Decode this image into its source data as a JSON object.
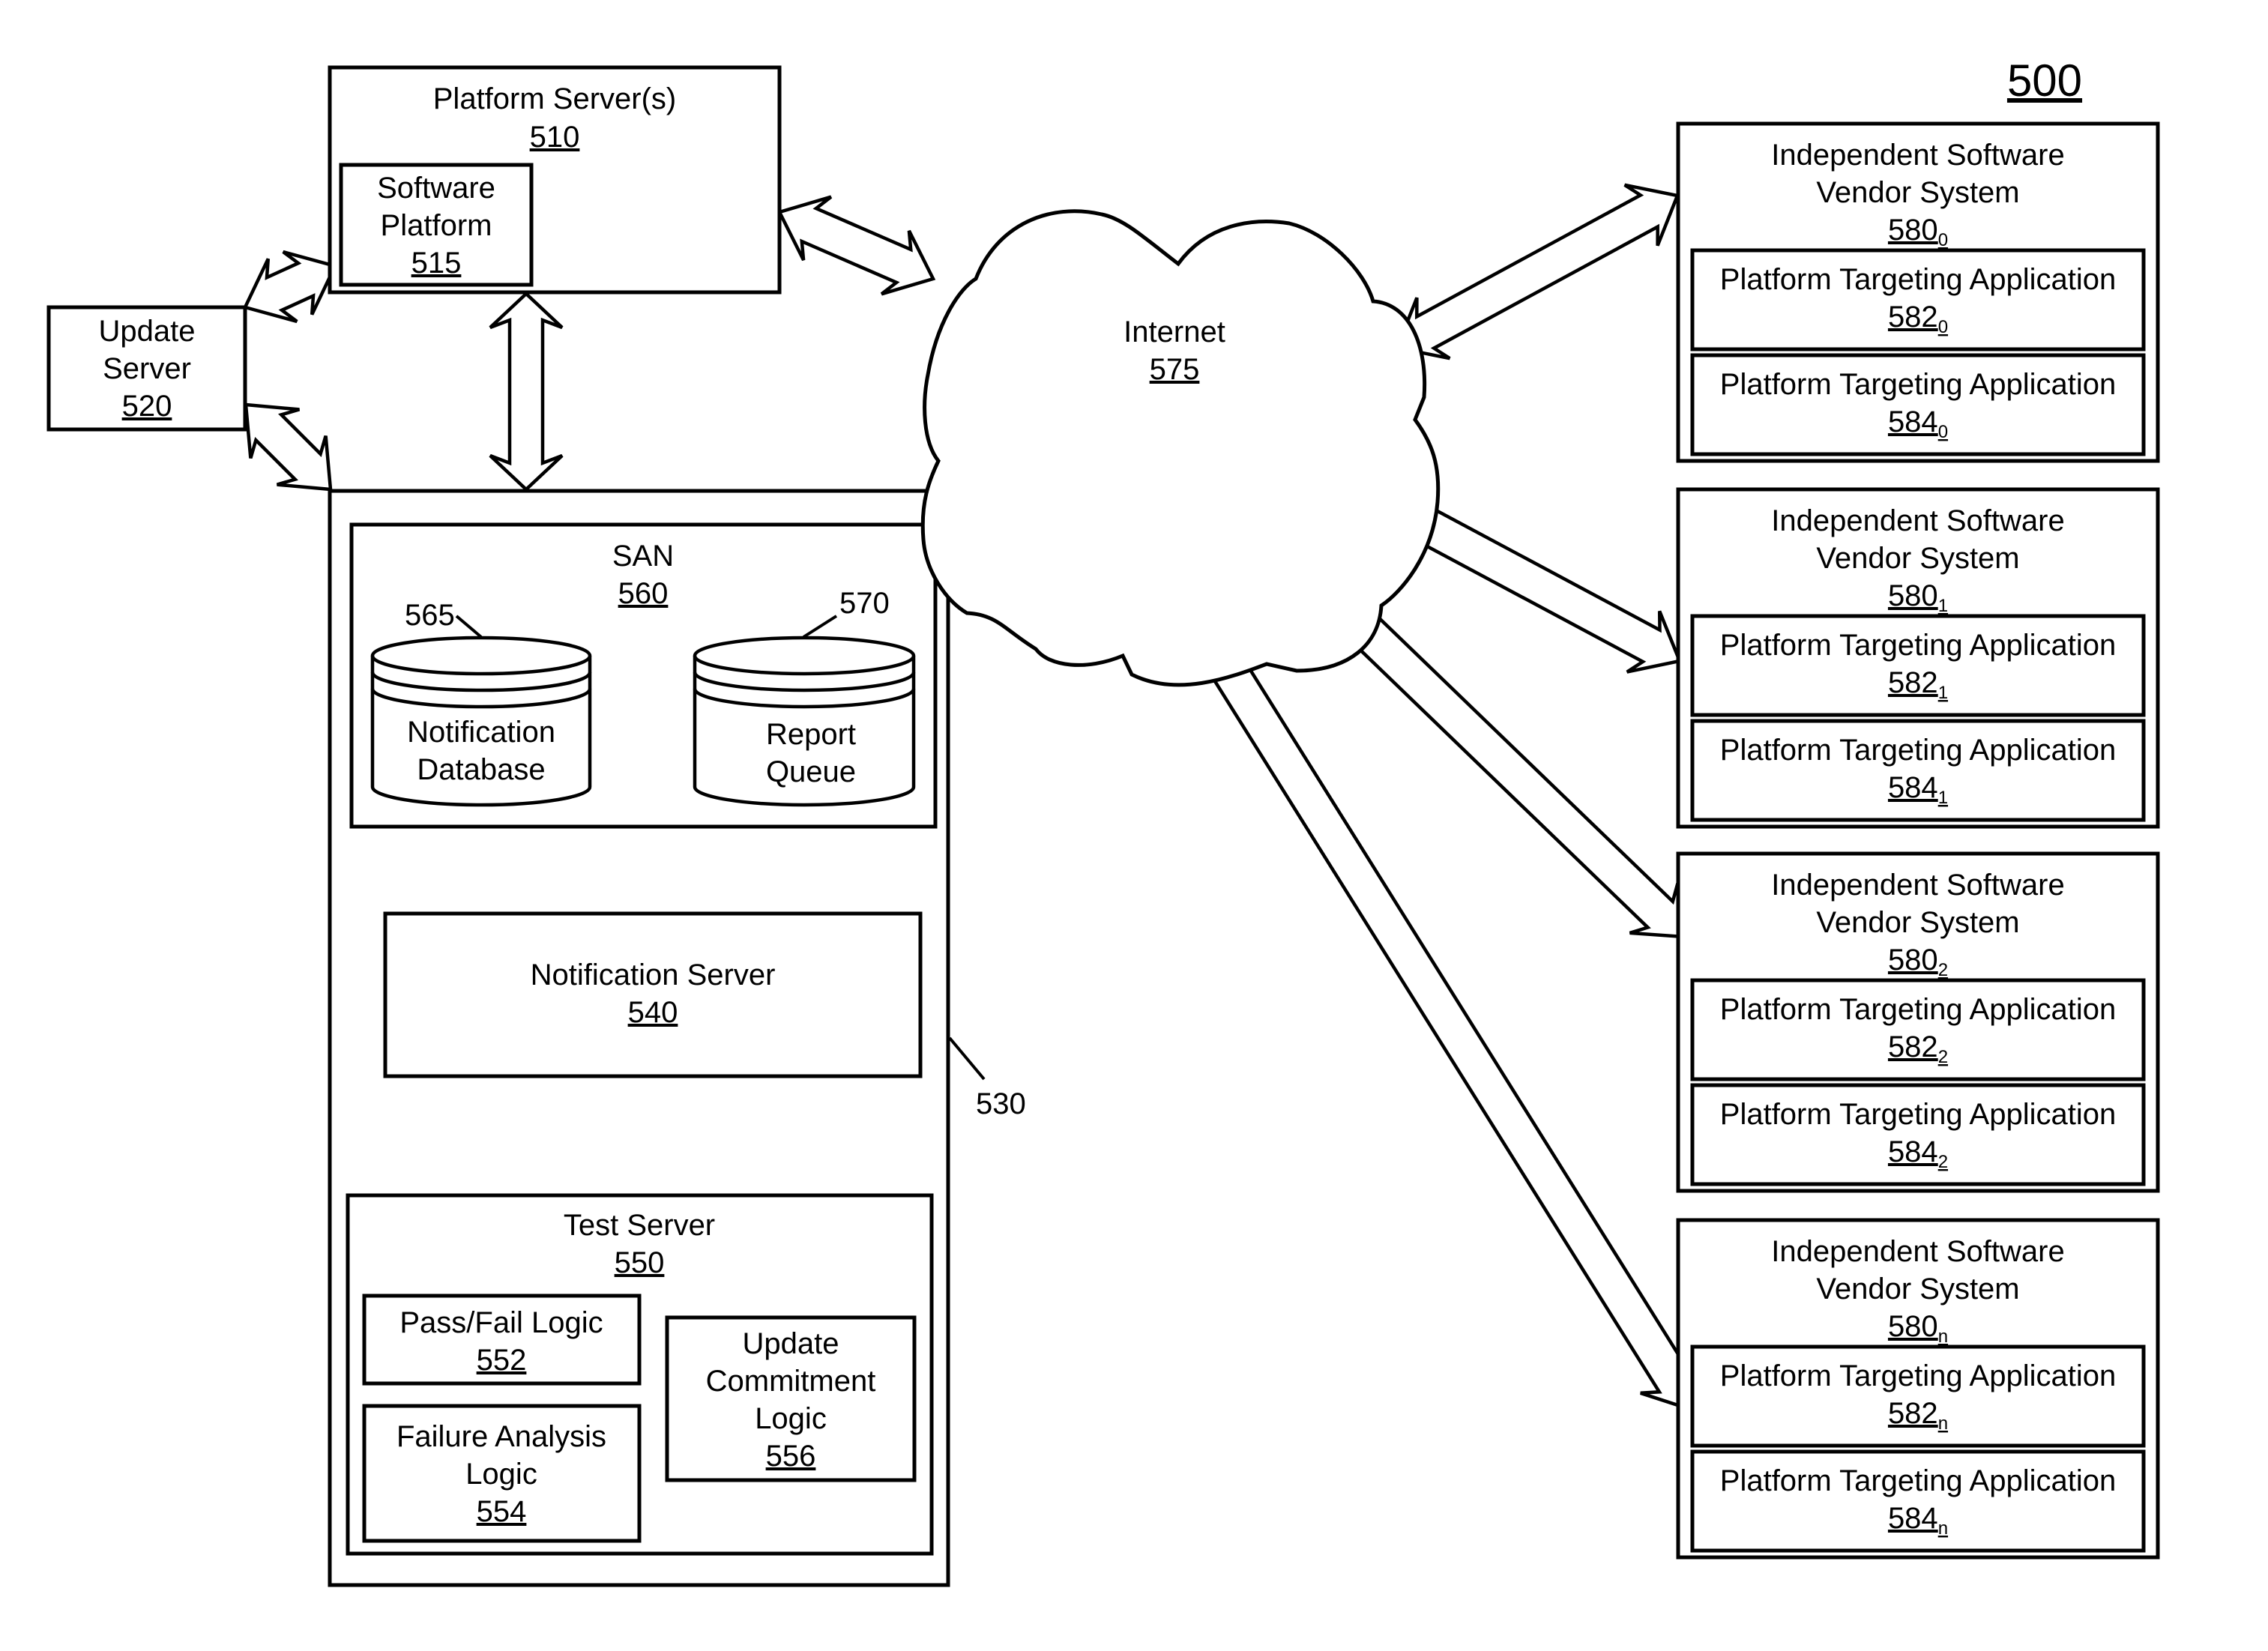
{
  "figure_number": "500",
  "platform_server": {
    "label": "Platform Server(s)",
    "number": "510"
  },
  "software_platform": {
    "line1": "Software",
    "line2": "Platform",
    "number": "515"
  },
  "update_server": {
    "line1": "Update",
    "line2": "Server",
    "number": "520"
  },
  "backend_group": {
    "reference": "530"
  },
  "san": {
    "label": "SAN",
    "number": "560"
  },
  "notification_database": {
    "line1": "Notification",
    "line2": "Database",
    "reference": "565"
  },
  "report_queue": {
    "line1": "Report",
    "line2": "Queue",
    "reference": "570"
  },
  "notification_server": {
    "label": "Notification Server",
    "number": "540"
  },
  "test_server": {
    "label": "Test Server",
    "number": "550"
  },
  "pass_fail_logic": {
    "label": "Pass/Fail Logic",
    "number": "552"
  },
  "failure_analysis_logic": {
    "line1": "Failure Analysis",
    "line2": "Logic",
    "number": "554"
  },
  "update_commitment_logic": {
    "line1": "Update",
    "line2": "Commitment",
    "line3": "Logic",
    "number": "556"
  },
  "internet": {
    "label": "Internet",
    "number": "575"
  },
  "isv_systems": [
    {
      "line1": "Independent Software",
      "line2": "Vendor System",
      "number": "580",
      "index": "0",
      "apps": [
        {
          "label": "Platform Targeting Application",
          "number": "582",
          "index": "0"
        },
        {
          "label": "Platform Targeting Application",
          "number": "584",
          "index": "0"
        }
      ]
    },
    {
      "line1": "Independent Software",
      "line2": "Vendor System",
      "number": "580",
      "index": "1",
      "apps": [
        {
          "label": "Platform Targeting Application",
          "number": "582",
          "index": "1"
        },
        {
          "label": "Platform Targeting Application",
          "number": "584",
          "index": "1"
        }
      ]
    },
    {
      "line1": "Independent Software",
      "line2": "Vendor System",
      "number": "580",
      "index": "2",
      "apps": [
        {
          "label": "Platform Targeting Application",
          "number": "582",
          "index": "2"
        },
        {
          "label": "Platform Targeting Application",
          "number": "584",
          "index": "2"
        }
      ]
    },
    {
      "line1": "Independent Software",
      "line2": "Vendor System",
      "number": "580",
      "index": "n",
      "apps": [
        {
          "label": "Platform Targeting Application",
          "number": "582",
          "index": "n"
        },
        {
          "label": "Platform Targeting Application",
          "number": "584",
          "index": "n"
        }
      ]
    }
  ],
  "connections": [
    {
      "from": "update_server",
      "to": "software_platform"
    },
    {
      "from": "update_server",
      "to": "backend_group"
    },
    {
      "from": "platform_server",
      "to": "backend_group"
    },
    {
      "from": "platform_server",
      "to": "internet"
    },
    {
      "from": "internet",
      "to": "isv_system_0"
    },
    {
      "from": "internet",
      "to": "isv_system_1"
    },
    {
      "from": "internet",
      "to": "isv_system_2"
    },
    {
      "from": "internet",
      "to": "isv_system_n"
    }
  ]
}
